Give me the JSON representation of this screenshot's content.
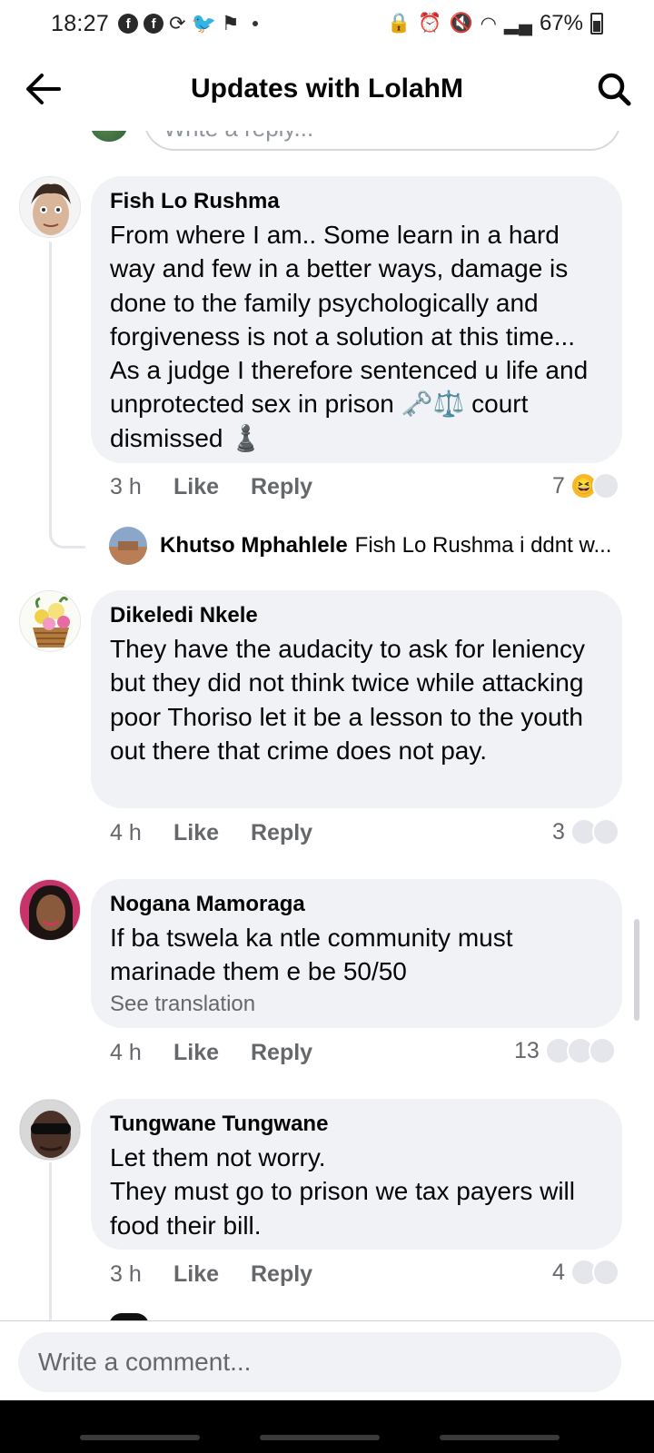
{
  "status_bar": {
    "time": "18:27",
    "left_icons": [
      "facebook-icon",
      "facebook-icon",
      "sync-icon",
      "twitter-icon",
      "notification-icon"
    ],
    "right_icons": [
      "lock-icon",
      "alarm-icon",
      "mute-icon",
      "wifi-icon",
      "signal-icon"
    ],
    "battery": "67%"
  },
  "header": {
    "title": "Updates with LolahM"
  },
  "partial_reply_placeholder": "Write a reply...",
  "comments": [
    {
      "name": "Fish Lo Rushma",
      "text": "From where I am.. Some learn in a hard way and few in a better ways, damage is done to the family psychologically and forgiveness is not a solution at this time... As a judge I therefore sentenced u life and unprotected sex in prison 🗝️⚖️ court dismissed ♟️",
      "time": "3 h",
      "like": "Like",
      "reply": "Reply",
      "reaction_count": "7",
      "reply_preview": {
        "name": "Khutso Mphahlele",
        "text": "Fish Lo Rushma i ddnt w..."
      }
    },
    {
      "name": "Dikeledi Nkele",
      "text": "They have the audacity to ask for leniency but they did not think twice while attacking poor Thoriso let it be a lesson to the youth out there that crime does not pay.",
      "time": "4 h",
      "like": "Like",
      "reply": "Reply",
      "reaction_count": "3"
    },
    {
      "name": "Nogana Mamoraga",
      "text": "If ba tswela ka ntle community must marinade them e be 50/50",
      "see_translation": "See translation",
      "time": "4 h",
      "like": "Like",
      "reply": "Reply",
      "reaction_count": "13"
    },
    {
      "name": "Tungwane Tungwane",
      "text": "Let them not worry.\nThey must go to prison we tax payers will food their bill.",
      "time": "3 h",
      "like": "Like",
      "reply": "Reply",
      "reaction_count": "4"
    }
  ],
  "composer": {
    "placeholder": "Write a comment..."
  },
  "colors": {
    "bubble": "#f0f2f5",
    "secondary_text": "#65676b",
    "haha_reaction": "#f7b928"
  }
}
